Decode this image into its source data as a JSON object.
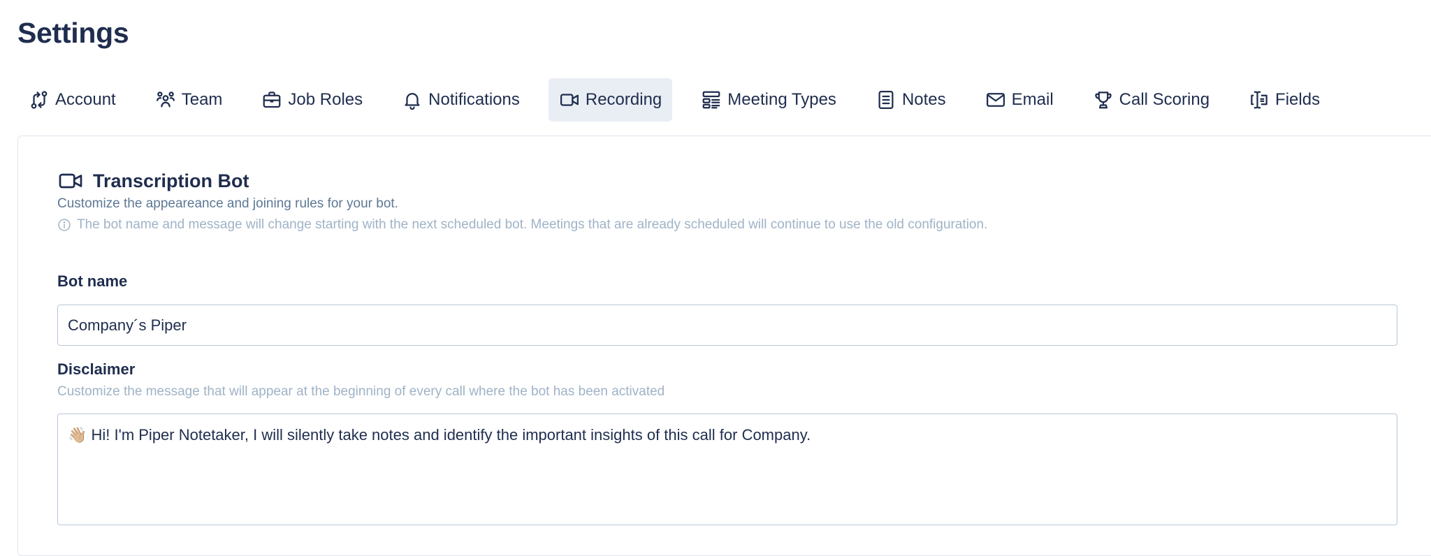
{
  "page": {
    "title": "Settings"
  },
  "tabs": [
    {
      "label": "Account",
      "icon": "account-flow-icon",
      "active": false
    },
    {
      "label": "Team",
      "icon": "team-icon",
      "active": false
    },
    {
      "label": "Job Roles",
      "icon": "briefcase-icon",
      "active": false
    },
    {
      "label": "Notifications",
      "icon": "bell-icon",
      "active": false
    },
    {
      "label": "Recording",
      "icon": "video-camera-icon",
      "active": true
    },
    {
      "label": "Meeting Types",
      "icon": "layout-list-icon",
      "active": false
    },
    {
      "label": "Notes",
      "icon": "document-icon",
      "active": false
    },
    {
      "label": "Email",
      "icon": "mail-icon",
      "active": false
    },
    {
      "label": "Call Scoring",
      "icon": "trophy-icon",
      "active": false
    },
    {
      "label": "Fields",
      "icon": "text-cursor-icon",
      "active": false
    }
  ],
  "section": {
    "title": "Transcription Bot",
    "description": "Customize the appeareance and joining rules for your bot.",
    "info": "The bot name and message will change starting with the next scheduled bot. Meetings that are already scheduled will continue to use the old configuration."
  },
  "bot_name": {
    "label": "Bot name",
    "value": "Company´s Piper"
  },
  "disclaimer": {
    "label": "Disclaimer",
    "help": "Customize the message that will appear at the beginning of every call where the bot has been activated",
    "value": "👋🏼 Hi! I'm Piper Notetaker, I will silently take notes and identify the important insights of this call for Company."
  },
  "colors": {
    "text": "#1f2d4e",
    "muted": "#5d7895",
    "light": "#9fb3c6",
    "active_tab_bg": "#e9eef4",
    "border": "#b6c8da"
  }
}
